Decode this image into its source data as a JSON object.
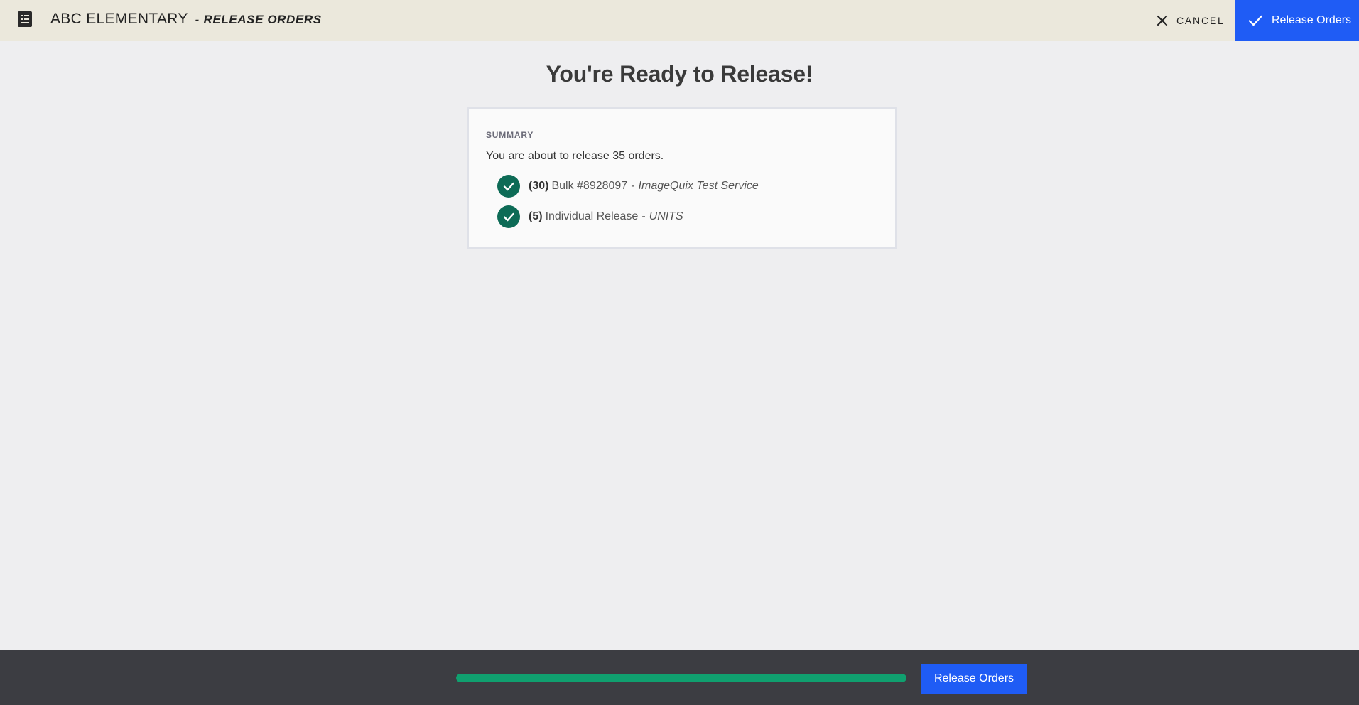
{
  "header": {
    "icon": "document-list-icon",
    "school": "ABC ELEMENTARY",
    "separator": "-",
    "subtitle": "RELEASE ORDERS",
    "cancel_label": "CANCEL",
    "cancel_icon": "close-icon",
    "release_label": "Release Orders",
    "release_icon": "check-icon"
  },
  "main": {
    "title": "You're Ready to Release!",
    "summary": {
      "heading": "SUMMARY",
      "text": "You are about to release 35 orders.",
      "items": [
        {
          "count": "(30)",
          "name": "Bulk #8928097",
          "dash": "-",
          "service": "ImageQuix Test Service"
        },
        {
          "count": "(5)",
          "name": "Individual Release",
          "dash": "-",
          "service": "UNITS"
        }
      ]
    }
  },
  "footer": {
    "progress": 1.0,
    "release_label": "Release Orders"
  },
  "colors": {
    "accent": "#1f5cf5",
    "success": "#0d6b56",
    "progress": "#10a06f",
    "header_bg": "#ebe8dc",
    "footer_bg": "#3c3d42"
  }
}
